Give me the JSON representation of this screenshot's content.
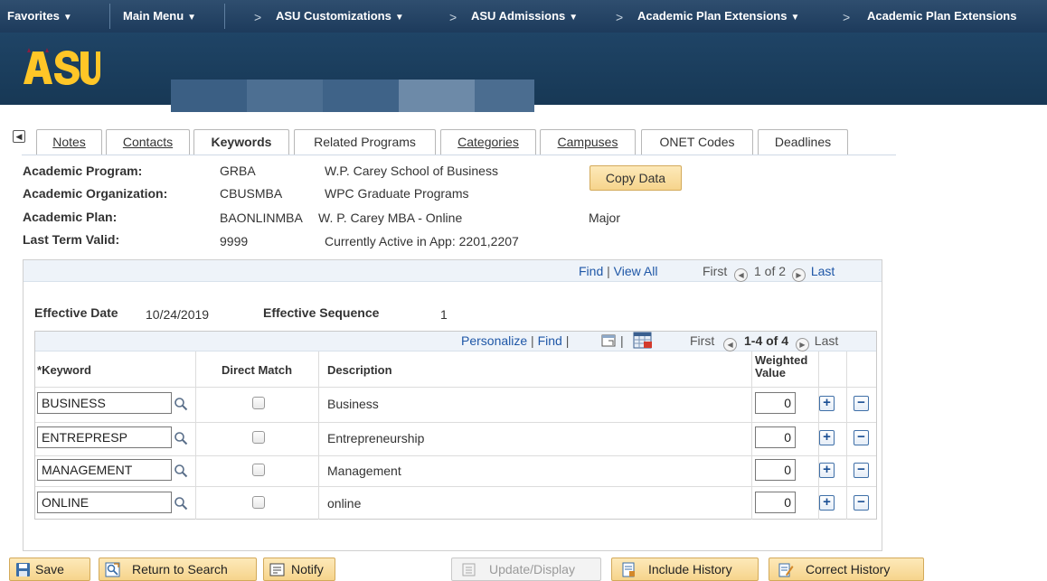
{
  "nav": {
    "favorites": "Favorites",
    "main_menu": "Main Menu",
    "breadcrumbs": [
      "ASU Customizations",
      "ASU Admissions",
      "Academic Plan Extensions",
      "Academic Plan Extensions"
    ],
    "caret": "▼",
    "chevron": ">"
  },
  "tabs": [
    "Notes",
    "Contacts",
    "Keywords",
    "Related Programs",
    "Categories",
    "Campuses",
    "ONET Codes",
    "Deadlines"
  ],
  "tab_active": "Keywords",
  "header": {
    "program_label": "Academic Program:",
    "program_code": "GRBA",
    "program_desc": "W.P. Carey School of Business",
    "org_label": "Academic Organization:",
    "org_code": "CBUSMBA",
    "org_desc": "WPC Graduate Programs",
    "plan_label": "Academic Plan:",
    "plan_code": "BAONLINMBA",
    "plan_desc": "W. P. Carey MBA - Online",
    "plan_type": "Major",
    "term_label": "Last Term Valid:",
    "term_code": "9999",
    "term_desc": "Currently Active in App: 2201,2207",
    "copy_button": "Copy Data"
  },
  "outer_nav": {
    "find": "Find",
    "view_all": "View All",
    "first": "First",
    "count": "1 of 2",
    "last": "Last",
    "sep": "|"
  },
  "effective": {
    "date_label": "Effective Date",
    "date_value": "10/24/2019",
    "seq_label": "Effective Sequence",
    "seq_value": "1"
  },
  "grid_nav": {
    "personalize": "Personalize",
    "find": "Find",
    "first": "First",
    "count": "1-4 of 4",
    "last": "Last",
    "sep": "|"
  },
  "columns": {
    "keyword_req": "*",
    "keyword": "Keyword",
    "direct_match": "Direct Match",
    "description": "Description",
    "weighted_1": "Weighted",
    "weighted_2": "Value"
  },
  "rows": [
    {
      "keyword": "BUSINESS",
      "description": "Business",
      "weight": "0"
    },
    {
      "keyword": "ENTREPRESP",
      "description": "Entrepreneurship",
      "weight": "0"
    },
    {
      "keyword": "MANAGEMENT",
      "description": "Management",
      "weight": "0"
    },
    {
      "keyword": "ONLINE",
      "description": "online",
      "weight": "0"
    }
  ],
  "toolbar": {
    "save": "Save",
    "return": "Return to Search",
    "notify": "Notify",
    "update": "Update/Display",
    "include": "Include History",
    "correct": "Correct History"
  },
  "colors": {
    "nav_bg": "#1d3b5c",
    "accent_link": "#1f57a7",
    "button_gold": "#f6d48c"
  }
}
